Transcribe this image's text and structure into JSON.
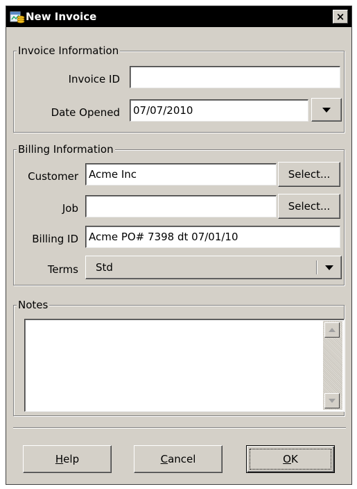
{
  "window": {
    "title": "New Invoice",
    "close_label": "×"
  },
  "invoice_info": {
    "legend": "Invoice Information",
    "invoice_id_label": "Invoice ID",
    "invoice_id_value": "",
    "date_opened_label": "Date Opened",
    "date_opened_value": "07/07/2010"
  },
  "billing_info": {
    "legend": "Billing Information",
    "customer_label": "Customer",
    "customer_value": "Acme Inc",
    "customer_select_label": "Select...",
    "job_label": "Job",
    "job_value": "",
    "job_select_label": "Select...",
    "billing_id_label": "Billing ID",
    "billing_id_value": "Acme PO# 7398 dt 07/01/10",
    "terms_label": "Terms",
    "terms_value": "Std"
  },
  "notes": {
    "legend": "Notes",
    "value": ""
  },
  "buttons": {
    "help_mnemonic": "H",
    "help_rest": "elp",
    "cancel_mnemonic": "C",
    "cancel_rest": "ancel",
    "ok_mnemonic": "O",
    "ok_rest": "K"
  }
}
